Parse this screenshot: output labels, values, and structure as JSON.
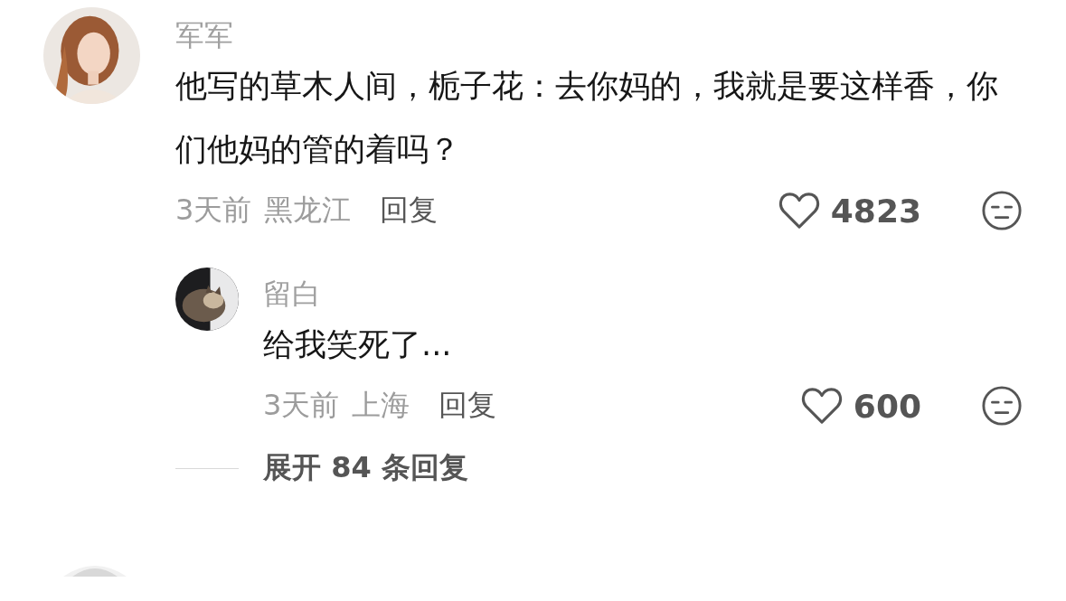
{
  "comments": [
    {
      "user": "军军",
      "text": "他写的草木人间，栀子花：去你妈的，我就是要这样香，你们他妈的管的着吗？",
      "time": "3天前",
      "location": "黑龙江",
      "reply_label": "回复",
      "likes": "4823",
      "replies": [
        {
          "user": "留白",
          "text": "给我笑死了...",
          "time": "3天前",
          "location": "上海",
          "reply_label": "回复",
          "likes": "600"
        }
      ],
      "expand_label": "展开 84 条回复"
    }
  ]
}
